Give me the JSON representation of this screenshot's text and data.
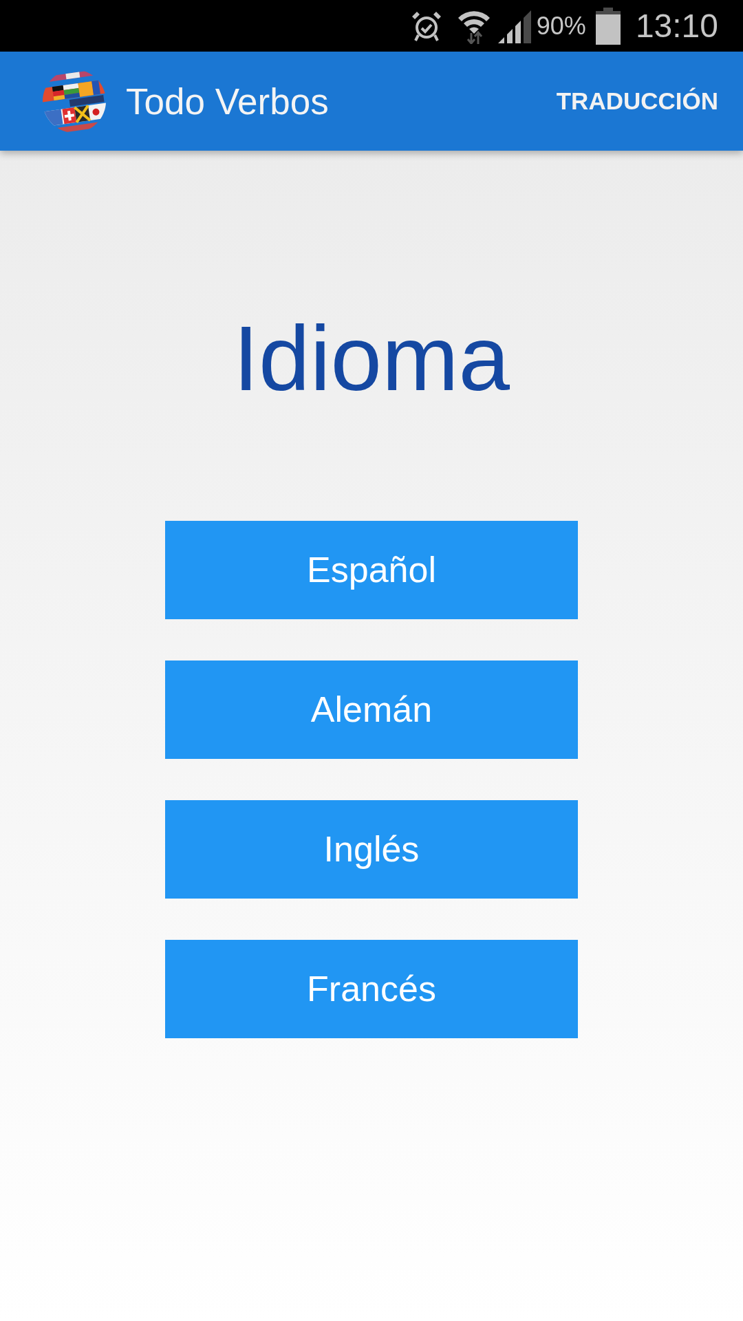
{
  "status_bar": {
    "battery": "90%",
    "time": "13:10"
  },
  "app_bar": {
    "title": "Todo Verbos",
    "action": "TRADUCCIÓN"
  },
  "heading": "Idioma",
  "languages": [
    {
      "label": "Español"
    },
    {
      "label": "Alemán"
    },
    {
      "label": "Inglés"
    },
    {
      "label": "Francés"
    }
  ]
}
